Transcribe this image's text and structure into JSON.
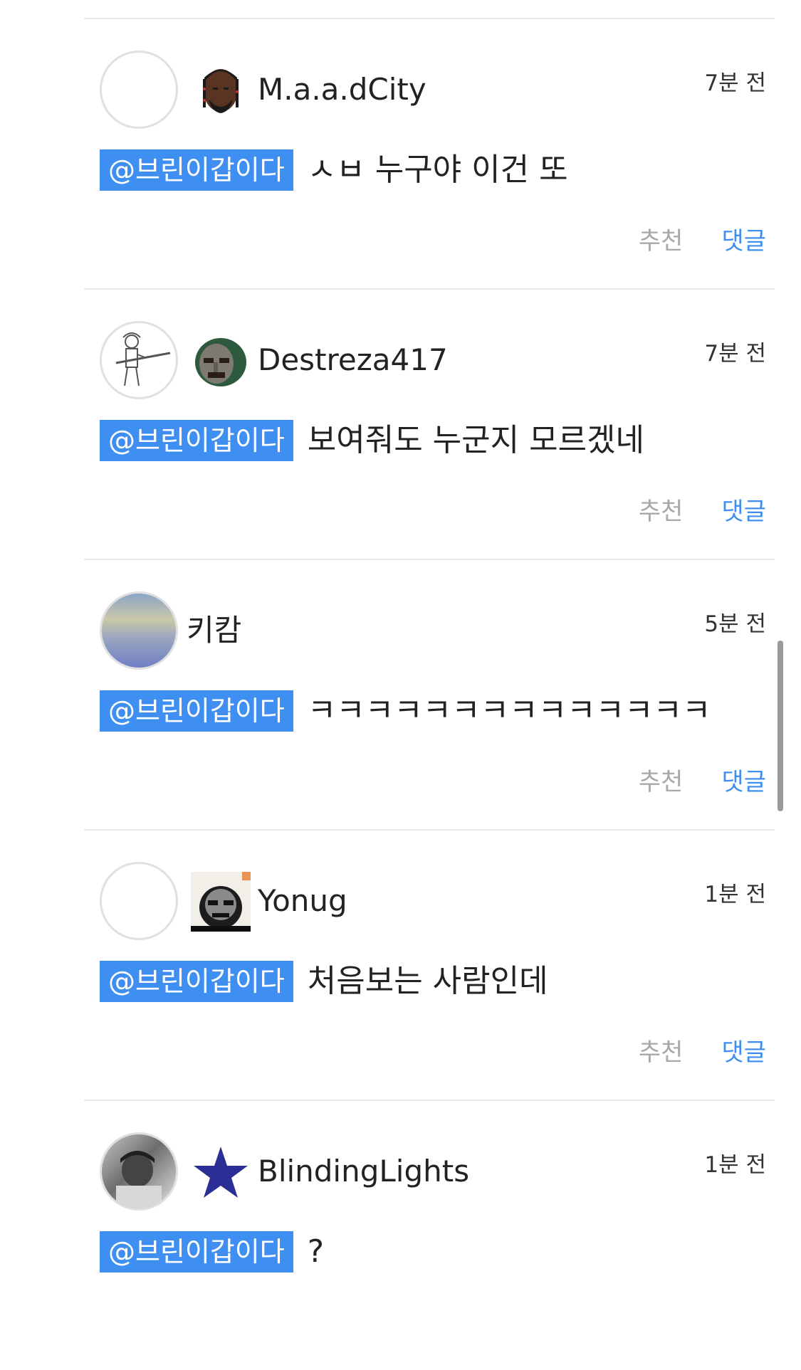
{
  "comments": [
    {
      "username": "M.a.a.dCity",
      "time": "7분 전",
      "mention": "@브린이갑이다",
      "text": "ㅅㅂ 누구야 이건 또",
      "recommend": "추천",
      "reply": "댓글",
      "avatar_icon": "empty-circle-avatar",
      "badge_icon": "rapper-portrait-icon"
    },
    {
      "username": "Destreza417",
      "time": "7분 전",
      "mention": "@브린이갑이다",
      "text": "보여줘도 누군지 모르겠네",
      "recommend": "추천",
      "reply": "댓글",
      "avatar_icon": "soldier-sketch-avatar",
      "badge_icon": "metal-mask-icon"
    },
    {
      "username": "키캄",
      "time": "5분 전",
      "mention": "@브린이갑이다",
      "text": "ㅋㅋㅋㅋㅋㅋㅋㅋㅋㅋㅋㅋㅋㅋ",
      "recommend": "추천",
      "reply": "댓글",
      "avatar_icon": "sky-painting-avatar",
      "badge_icon": ""
    },
    {
      "username": "Yonug",
      "time": "1분 전",
      "mention": "@브린이갑이다",
      "text": "처음보는 사람인데",
      "recommend": "추천",
      "reply": "댓글",
      "avatar_icon": "empty-circle-avatar",
      "badge_icon": "album-cover-icon"
    },
    {
      "username": "BlindingLights",
      "time": "1분 전",
      "mention": "@브린이갑이다",
      "text": "?",
      "recommend": "추천",
      "reply": "댓글",
      "avatar_icon": "photo-avatar",
      "badge_icon": "star-icon"
    }
  ],
  "colors": {
    "accent": "#3f8ff2",
    "muted": "#a8a8a8",
    "divider": "#ebebeb"
  }
}
